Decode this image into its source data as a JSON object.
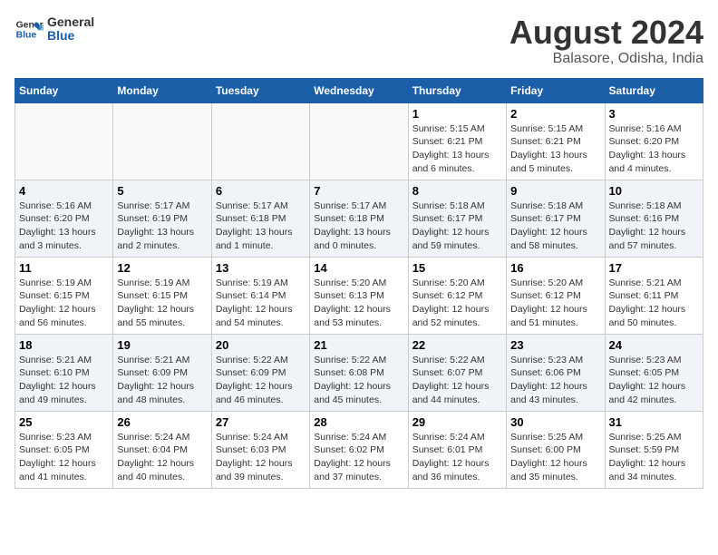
{
  "logo": {
    "line1": "General",
    "line2": "Blue"
  },
  "title": "August 2024",
  "subtitle": "Balasore, Odisha, India",
  "weekdays": [
    "Sunday",
    "Monday",
    "Tuesday",
    "Wednesday",
    "Thursday",
    "Friday",
    "Saturday"
  ],
  "weeks": [
    [
      {
        "day": "",
        "info": ""
      },
      {
        "day": "",
        "info": ""
      },
      {
        "day": "",
        "info": ""
      },
      {
        "day": "",
        "info": ""
      },
      {
        "day": "1",
        "info": "Sunrise: 5:15 AM\nSunset: 6:21 PM\nDaylight: 13 hours\nand 6 minutes."
      },
      {
        "day": "2",
        "info": "Sunrise: 5:15 AM\nSunset: 6:21 PM\nDaylight: 13 hours\nand 5 minutes."
      },
      {
        "day": "3",
        "info": "Sunrise: 5:16 AM\nSunset: 6:20 PM\nDaylight: 13 hours\nand 4 minutes."
      }
    ],
    [
      {
        "day": "4",
        "info": "Sunrise: 5:16 AM\nSunset: 6:20 PM\nDaylight: 13 hours\nand 3 minutes."
      },
      {
        "day": "5",
        "info": "Sunrise: 5:17 AM\nSunset: 6:19 PM\nDaylight: 13 hours\nand 2 minutes."
      },
      {
        "day": "6",
        "info": "Sunrise: 5:17 AM\nSunset: 6:18 PM\nDaylight: 13 hours\nand 1 minute."
      },
      {
        "day": "7",
        "info": "Sunrise: 5:17 AM\nSunset: 6:18 PM\nDaylight: 13 hours\nand 0 minutes."
      },
      {
        "day": "8",
        "info": "Sunrise: 5:18 AM\nSunset: 6:17 PM\nDaylight: 12 hours\nand 59 minutes."
      },
      {
        "day": "9",
        "info": "Sunrise: 5:18 AM\nSunset: 6:17 PM\nDaylight: 12 hours\nand 58 minutes."
      },
      {
        "day": "10",
        "info": "Sunrise: 5:18 AM\nSunset: 6:16 PM\nDaylight: 12 hours\nand 57 minutes."
      }
    ],
    [
      {
        "day": "11",
        "info": "Sunrise: 5:19 AM\nSunset: 6:15 PM\nDaylight: 12 hours\nand 56 minutes."
      },
      {
        "day": "12",
        "info": "Sunrise: 5:19 AM\nSunset: 6:15 PM\nDaylight: 12 hours\nand 55 minutes."
      },
      {
        "day": "13",
        "info": "Sunrise: 5:19 AM\nSunset: 6:14 PM\nDaylight: 12 hours\nand 54 minutes."
      },
      {
        "day": "14",
        "info": "Sunrise: 5:20 AM\nSunset: 6:13 PM\nDaylight: 12 hours\nand 53 minutes."
      },
      {
        "day": "15",
        "info": "Sunrise: 5:20 AM\nSunset: 6:12 PM\nDaylight: 12 hours\nand 52 minutes."
      },
      {
        "day": "16",
        "info": "Sunrise: 5:20 AM\nSunset: 6:12 PM\nDaylight: 12 hours\nand 51 minutes."
      },
      {
        "day": "17",
        "info": "Sunrise: 5:21 AM\nSunset: 6:11 PM\nDaylight: 12 hours\nand 50 minutes."
      }
    ],
    [
      {
        "day": "18",
        "info": "Sunrise: 5:21 AM\nSunset: 6:10 PM\nDaylight: 12 hours\nand 49 minutes."
      },
      {
        "day": "19",
        "info": "Sunrise: 5:21 AM\nSunset: 6:09 PM\nDaylight: 12 hours\nand 48 minutes."
      },
      {
        "day": "20",
        "info": "Sunrise: 5:22 AM\nSunset: 6:09 PM\nDaylight: 12 hours\nand 46 minutes."
      },
      {
        "day": "21",
        "info": "Sunrise: 5:22 AM\nSunset: 6:08 PM\nDaylight: 12 hours\nand 45 minutes."
      },
      {
        "day": "22",
        "info": "Sunrise: 5:22 AM\nSunset: 6:07 PM\nDaylight: 12 hours\nand 44 minutes."
      },
      {
        "day": "23",
        "info": "Sunrise: 5:23 AM\nSunset: 6:06 PM\nDaylight: 12 hours\nand 43 minutes."
      },
      {
        "day": "24",
        "info": "Sunrise: 5:23 AM\nSunset: 6:05 PM\nDaylight: 12 hours\nand 42 minutes."
      }
    ],
    [
      {
        "day": "25",
        "info": "Sunrise: 5:23 AM\nSunset: 6:05 PM\nDaylight: 12 hours\nand 41 minutes."
      },
      {
        "day": "26",
        "info": "Sunrise: 5:24 AM\nSunset: 6:04 PM\nDaylight: 12 hours\nand 40 minutes."
      },
      {
        "day": "27",
        "info": "Sunrise: 5:24 AM\nSunset: 6:03 PM\nDaylight: 12 hours\nand 39 minutes."
      },
      {
        "day": "28",
        "info": "Sunrise: 5:24 AM\nSunset: 6:02 PM\nDaylight: 12 hours\nand 37 minutes."
      },
      {
        "day": "29",
        "info": "Sunrise: 5:24 AM\nSunset: 6:01 PM\nDaylight: 12 hours\nand 36 minutes."
      },
      {
        "day": "30",
        "info": "Sunrise: 5:25 AM\nSunset: 6:00 PM\nDaylight: 12 hours\nand 35 minutes."
      },
      {
        "day": "31",
        "info": "Sunrise: 5:25 AM\nSunset: 5:59 PM\nDaylight: 12 hours\nand 34 minutes."
      }
    ]
  ]
}
